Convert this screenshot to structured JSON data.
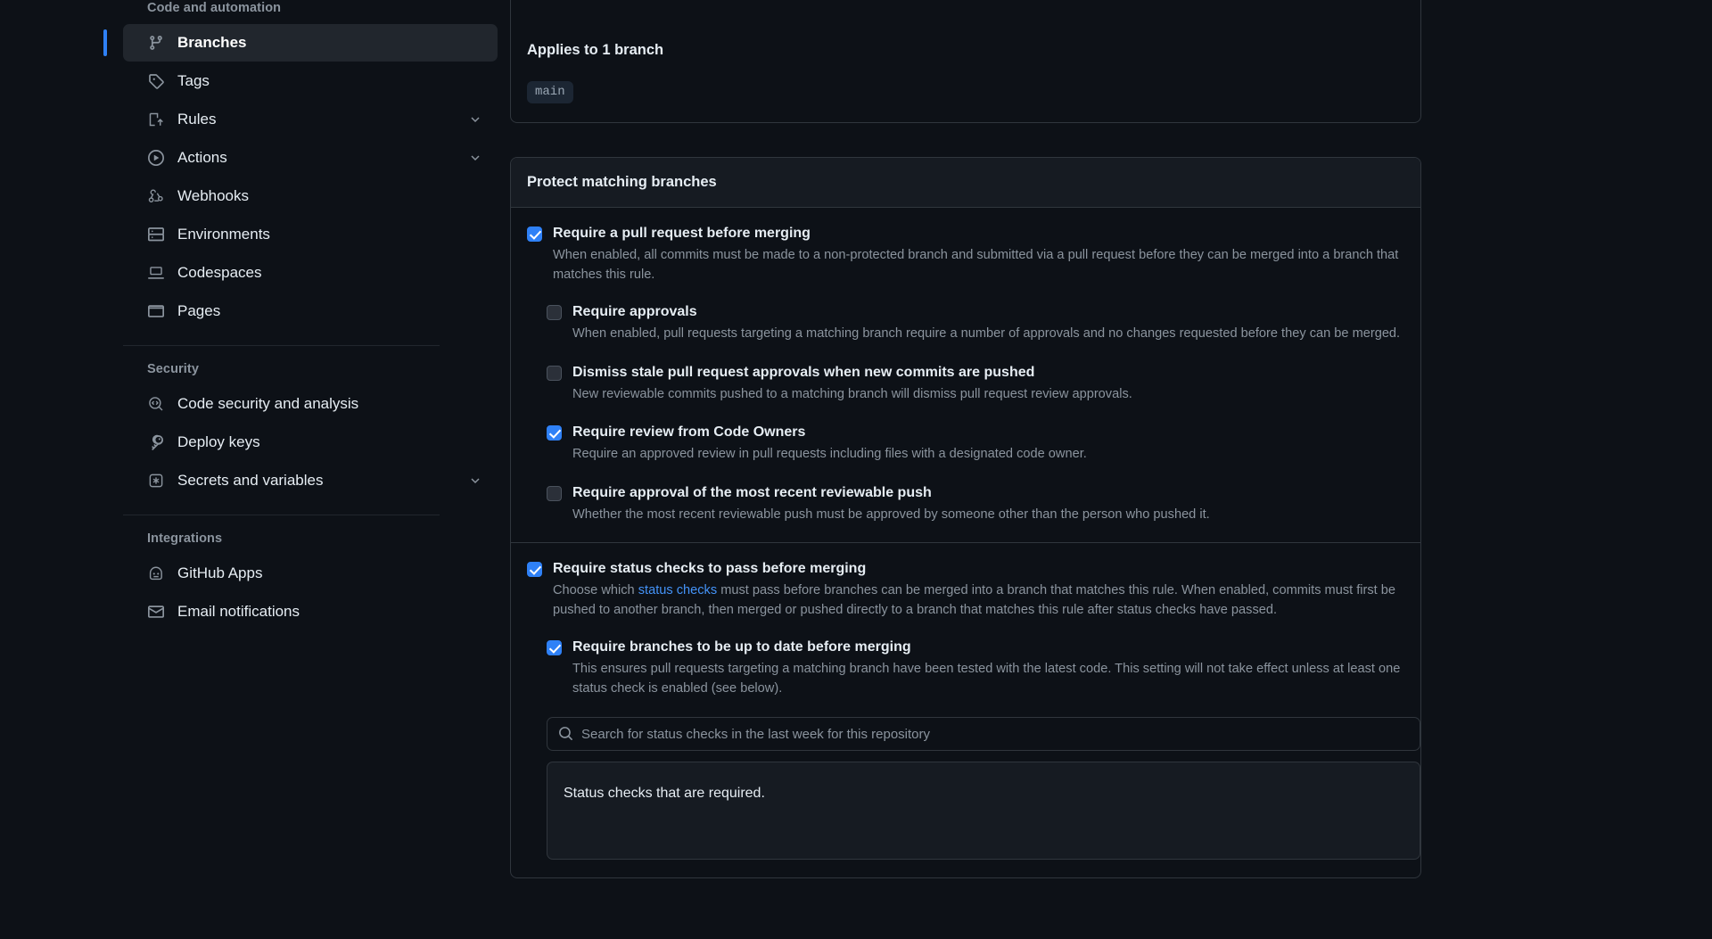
{
  "sidebar": {
    "groups": [
      {
        "title": "Code and automation",
        "items": [
          {
            "label": "Branches",
            "icon": "git-branch-icon",
            "active": true,
            "chevron": false
          },
          {
            "label": "Tags",
            "icon": "tag-icon",
            "active": false,
            "chevron": false
          },
          {
            "label": "Rules",
            "icon": "rules-icon",
            "active": false,
            "chevron": true
          },
          {
            "label": "Actions",
            "icon": "play-circle-icon",
            "active": false,
            "chevron": true
          },
          {
            "label": "Webhooks",
            "icon": "webhook-icon",
            "active": false,
            "chevron": false
          },
          {
            "label": "Environments",
            "icon": "server-icon",
            "active": false,
            "chevron": false
          },
          {
            "label": "Codespaces",
            "icon": "codespaces-icon",
            "active": false,
            "chevron": false
          },
          {
            "label": "Pages",
            "icon": "browser-icon",
            "active": false,
            "chevron": false
          }
        ]
      },
      {
        "title": "Security",
        "items": [
          {
            "label": "Code security and analysis",
            "icon": "code-scan-icon",
            "active": false,
            "chevron": false
          },
          {
            "label": "Deploy keys",
            "icon": "key-icon",
            "active": false,
            "chevron": false
          },
          {
            "label": "Secrets and variables",
            "icon": "secret-icon",
            "active": false,
            "chevron": true
          }
        ]
      },
      {
        "title": "Integrations",
        "items": [
          {
            "label": "GitHub Apps",
            "icon": "github-apps-icon",
            "active": false,
            "chevron": false
          },
          {
            "label": "Email notifications",
            "icon": "mail-icon",
            "active": false,
            "chevron": false
          }
        ]
      }
    ]
  },
  "main": {
    "applies_to": {
      "title": "Applies to 1 branch",
      "branch": "main"
    },
    "protect": {
      "header": "Protect matching branches",
      "pull_request": {
        "label": "Require a pull request before merging",
        "checked": true,
        "description": "When enabled, all commits must be made to a non-protected branch and submitted via a pull request before they can be merged into a branch that matches this rule.",
        "nested": [
          {
            "label": "Require approvals",
            "checked": false,
            "description": "When enabled, pull requests targeting a matching branch require a number of approvals and no changes requested before they can be merged."
          },
          {
            "label": "Dismiss stale pull request approvals when new commits are pushed",
            "checked": false,
            "description": "New reviewable commits pushed to a matching branch will dismiss pull request review approvals."
          },
          {
            "label": "Require review from Code Owners",
            "checked": true,
            "description": "Require an approved review in pull requests including files with a designated code owner."
          },
          {
            "label": "Require approval of the most recent reviewable push",
            "checked": false,
            "description": "Whether the most recent reviewable push must be approved by someone other than the person who pushed it."
          }
        ]
      },
      "status_checks": {
        "label": "Require status checks to pass before merging",
        "checked": true,
        "description_part1": "Choose which ",
        "description_link": "status checks",
        "description_part2": " must pass before branches can be merged into a branch that matches this rule. When enabled, commits must first be pushed to another branch, then merged or pushed directly to a branch that matches this rule after status checks have passed.",
        "up_to_date": {
          "label": "Require branches to be up to date before merging",
          "checked": true,
          "description": "This ensures pull requests targeting a matching branch have been tested with the latest code. This setting will not take effect unless at least one status check is enabled (see below)."
        },
        "search_placeholder": "Search for status checks in the last week for this repository",
        "search_value": "",
        "required_box_text": "Status checks that are required."
      }
    }
  },
  "colors": {
    "accent": "#2f81f7",
    "link": "#4493f8",
    "background": "#0d1117",
    "border": "#30363d",
    "muted_text": "#8b949e"
  }
}
